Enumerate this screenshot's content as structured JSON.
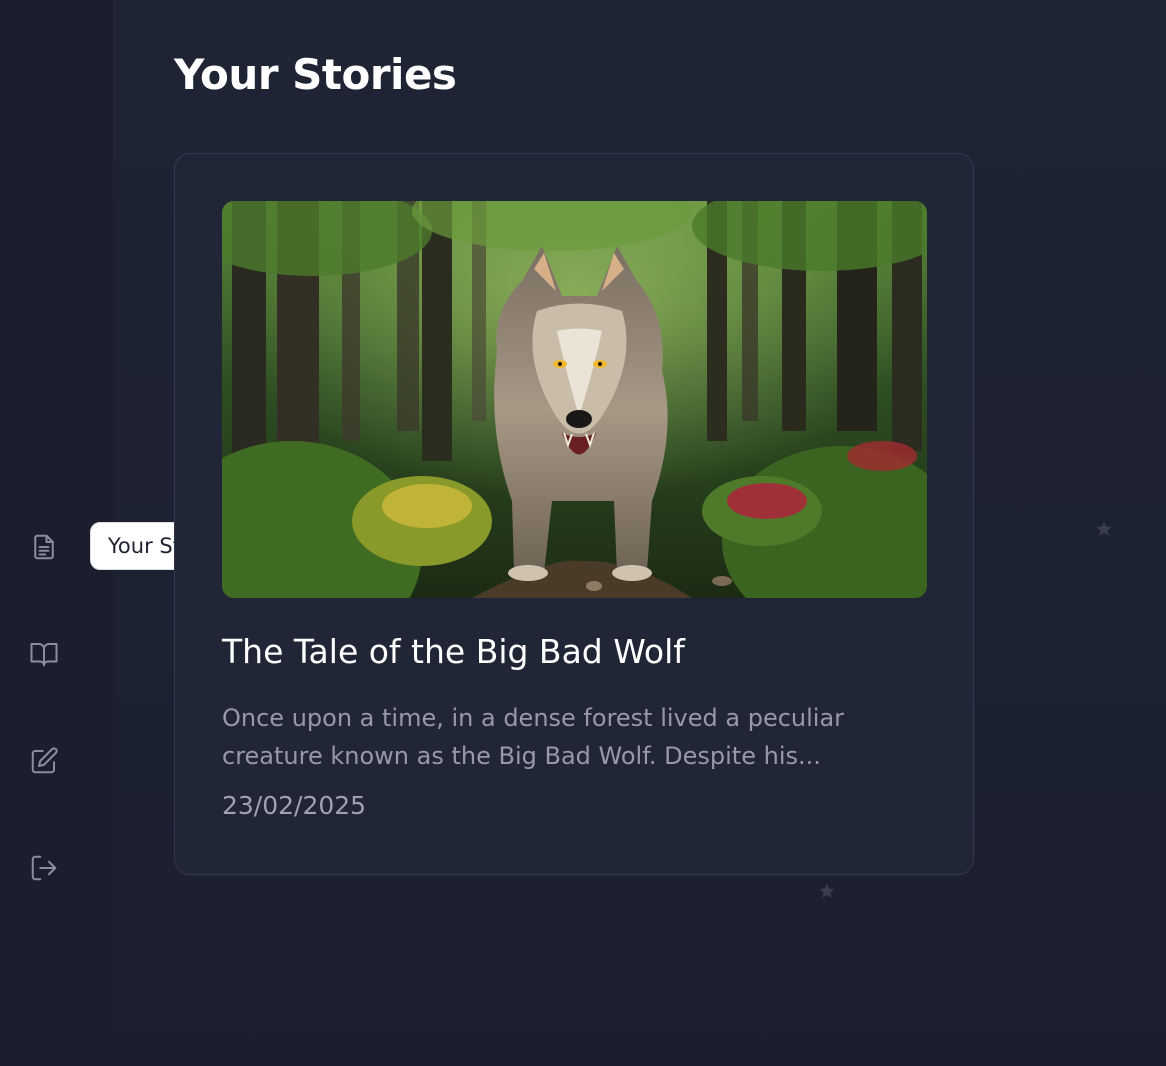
{
  "page": {
    "title": "Your Stories"
  },
  "sidebar": {
    "items": [
      {
        "icon": "document-icon",
        "label": "Your Stories"
      },
      {
        "icon": "book-open-icon",
        "label": ""
      },
      {
        "icon": "edit-icon",
        "label": ""
      },
      {
        "icon": "logout-icon",
        "label": ""
      }
    ],
    "tooltip": "Your Stories"
  },
  "stories": [
    {
      "title": "The Tale of the Big Bad Wolf",
      "excerpt": "Once upon a time, in a dense forest lived a peculiar creature known as the Big Bad Wolf. Despite his...",
      "date": "23/02/2025",
      "image": "wolf-in-forest"
    }
  ],
  "colors": {
    "background": "#1f2435",
    "sidebar": "#1b1f2d",
    "card": "#212637",
    "card_border": "#343a4d",
    "icon": "#8a8f9e",
    "muted_text": "#9599a8"
  }
}
